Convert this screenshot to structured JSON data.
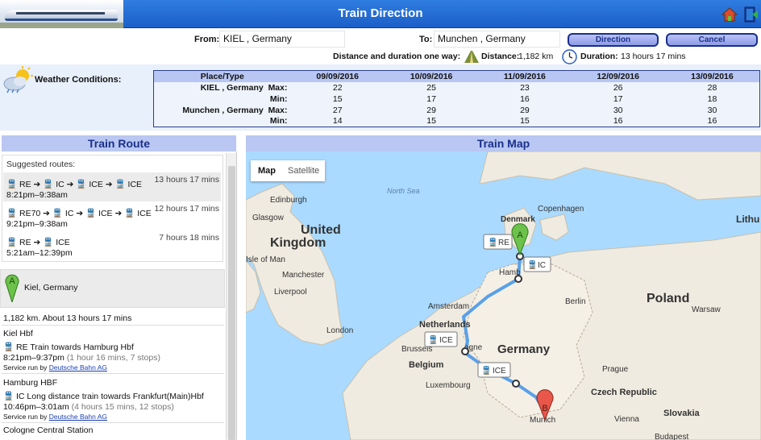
{
  "app": {
    "title": "Train Direction"
  },
  "form": {
    "from_label": "From:",
    "from_value": "KIEL , Germany",
    "to_label": "To:",
    "to_value": "Munchen , Germany",
    "direction_label": "Direction",
    "cancel_label": "Cancel"
  },
  "summary": {
    "intro": "Distance and duration one way:",
    "distance_label": "Distance:",
    "distance_value": "1,182 km",
    "duration_label": "Duration:",
    "duration_value": "13 hours 17 mins"
  },
  "weather": {
    "label": "Weather Conditions:",
    "headers": [
      "Place/Type",
      "09/09/2016",
      "10/09/2016",
      "11/09/2016",
      "12/09/2016",
      "13/09/2016"
    ],
    "rows": [
      {
        "place": "KIEL , Germany",
        "type": "Max:",
        "values": [
          "22",
          "25",
          "23",
          "26",
          "28"
        ]
      },
      {
        "place": "",
        "type": "Min:",
        "values": [
          "15",
          "17",
          "16",
          "17",
          "18"
        ]
      },
      {
        "place": "Munchen , Germany",
        "type": "Max:",
        "values": [
          "27",
          "29",
          "29",
          "30",
          "30"
        ]
      },
      {
        "place": "",
        "type": "Min:",
        "values": [
          "14",
          "15",
          "15",
          "16",
          "16"
        ]
      }
    ]
  },
  "route_panel": {
    "title": "Train Route",
    "suggested_label": "Suggested routes:",
    "routes": [
      {
        "legs": [
          "RE",
          "IC",
          "ICE",
          "ICE"
        ],
        "times": "8:21pm–9:38am",
        "duration": "13 hours 17 mins"
      },
      {
        "legs": [
          "RE70",
          "IC",
          "ICE",
          "ICE"
        ],
        "times": "9:21pm–9:38am",
        "duration": "12 hours 17 mins"
      },
      {
        "legs": [
          "RE",
          "ICE"
        ],
        "times": "5:21am–12:39pm",
        "duration": "7 hours 18 mins"
      }
    ],
    "start_marker": "A",
    "start_place": "Kiel, Germany",
    "total": "1,182 km. About 13 hours 17 mins",
    "steps": [
      {
        "station": "Kiel Hbf",
        "mode": "RE",
        "desc": "Train towards Hamburg Hbf",
        "time": "8:21pm–9:37pm",
        "detail": "(1 hour 16 mins, 7 stops)",
        "service_label": "Service run by",
        "operator": "Deutsche Bahn AG"
      },
      {
        "station": "Hamburg HBF",
        "mode": "IC",
        "desc": "Long distance train towards Frankfurt(Main)Hbf",
        "time": "10:46pm–3:01am",
        "detail": "(4 hours 15 mins, 12 stops)",
        "service_label": "Service run by",
        "operator": "Deutsche Bahn AG"
      }
    ],
    "next_station": "Cologne Central Station"
  },
  "map_panel": {
    "title": "Train Map",
    "map_button": "Map",
    "satellite_button": "Satellite",
    "labels": {
      "north_sea": "North Sea",
      "edinburgh": "Edinburgh",
      "glasgow": "Glasgow",
      "uk1": "United",
      "uk2": "Kingdom",
      "isle_of_man": "Isle of Man",
      "manchester": "Manchester",
      "liverpool": "Liverpool",
      "london": "London",
      "denmark": "Denmark",
      "copenhagen": "Copenhagen",
      "lithuania": "Lithu",
      "hamburg": "Hamb",
      "poland": "Poland",
      "warsaw": "Warsaw",
      "amsterdam": "Amsterdam",
      "netherlands": "Netherlands",
      "berlin": "Berlin",
      "germany": "Germany",
      "brussels": "Brussels",
      "belgium": "Belgium",
      "cologne": "ogne",
      "luxembourg": "Luxembourg",
      "prague": "Prague",
      "czech": "Czech Republic",
      "slovakia": "Slovakia",
      "vienna": "Vienna",
      "munich": "Munich",
      "budapest": "Budapest"
    },
    "route_tags": [
      "RE",
      "IC",
      "ICE",
      "ICE"
    ],
    "marker_a": "A",
    "marker_b": "B"
  }
}
